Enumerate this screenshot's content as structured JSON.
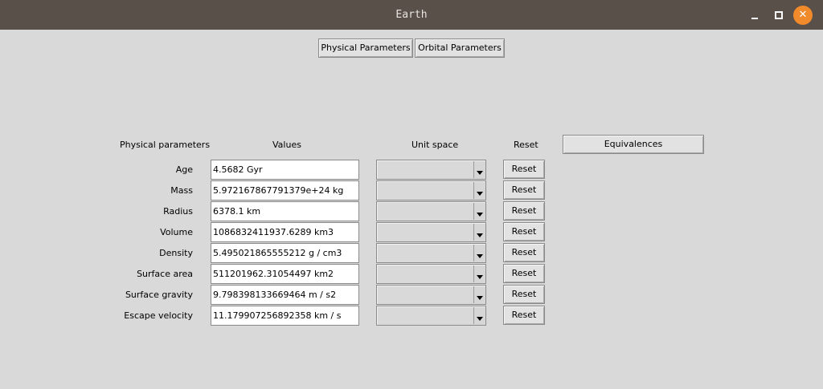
{
  "window": {
    "title": "Earth",
    "close_glyph": "✕"
  },
  "tabs": [
    {
      "label": "Physical Parameters"
    },
    {
      "label": "Orbital Parameters"
    }
  ],
  "headers": {
    "parameters": "Physical parameters",
    "values": "Values",
    "unit_space": "Unit space",
    "reset": "Reset",
    "equivalences": "Equivalences"
  },
  "rows": [
    {
      "label": "Age",
      "value": "4.5682 Gyr",
      "reset": "Reset"
    },
    {
      "label": "Mass",
      "value": "5.972167867791379e+24 kg",
      "reset": "Reset"
    },
    {
      "label": "Radius",
      "value": "6378.1 km",
      "reset": "Reset"
    },
    {
      "label": "Volume",
      "value": "1086832411937.6289 km3",
      "reset": "Reset"
    },
    {
      "label": "Density",
      "value": "5.495021865555212 g / cm3",
      "reset": "Reset"
    },
    {
      "label": "Surface area",
      "value": "511201962.31054497 km2",
      "reset": "Reset"
    },
    {
      "label": "Surface gravity",
      "value": "9.798398133669464 m / s2",
      "reset": "Reset"
    },
    {
      "label": "Escape velocity",
      "value": "11.179907256892358 km / s",
      "reset": "Reset"
    }
  ],
  "colors": {
    "titlebar": "#5a504a",
    "background": "#d9d9d9",
    "close_button": "#f08a2a"
  }
}
